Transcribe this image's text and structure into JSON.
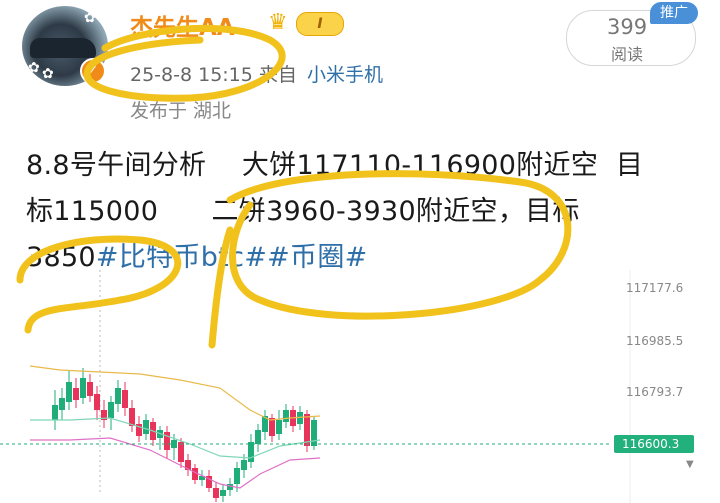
{
  "author": {
    "name": "杰先生AA",
    "level": "I",
    "timestamp": "25-8-8 15:15",
    "source_prefix": "来自",
    "device": "小米手机",
    "location": "发布于 湖北"
  },
  "reads": {
    "count": "399",
    "label": "阅读"
  },
  "promo_badge": "推广",
  "post": {
    "line1": "8.8号午间分析    大饼117110-116900附近空  目",
    "line2a": "标115000      二饼3960-3930附近空，目标",
    "line3_value": "3850",
    "line3_tags": "#比特币btc##币圈#"
  },
  "chart_data": {
    "type": "candlestick",
    "y_ticks": [
      "117177.6",
      "116985.5",
      "116793.7"
    ],
    "current_price": "116600.3",
    "colors": {
      "up": "#1fae7a",
      "down": "#e8345a",
      "upper_band": "#e9b94a",
      "mid_band": "#7fd6b6",
      "lower_band": "#e070c8",
      "price_line": "#1fae7a",
      "price_tag": "#22b07d"
    }
  },
  "icons": {
    "verified": "verified-v-icon",
    "crown": "crown-icon"
  }
}
